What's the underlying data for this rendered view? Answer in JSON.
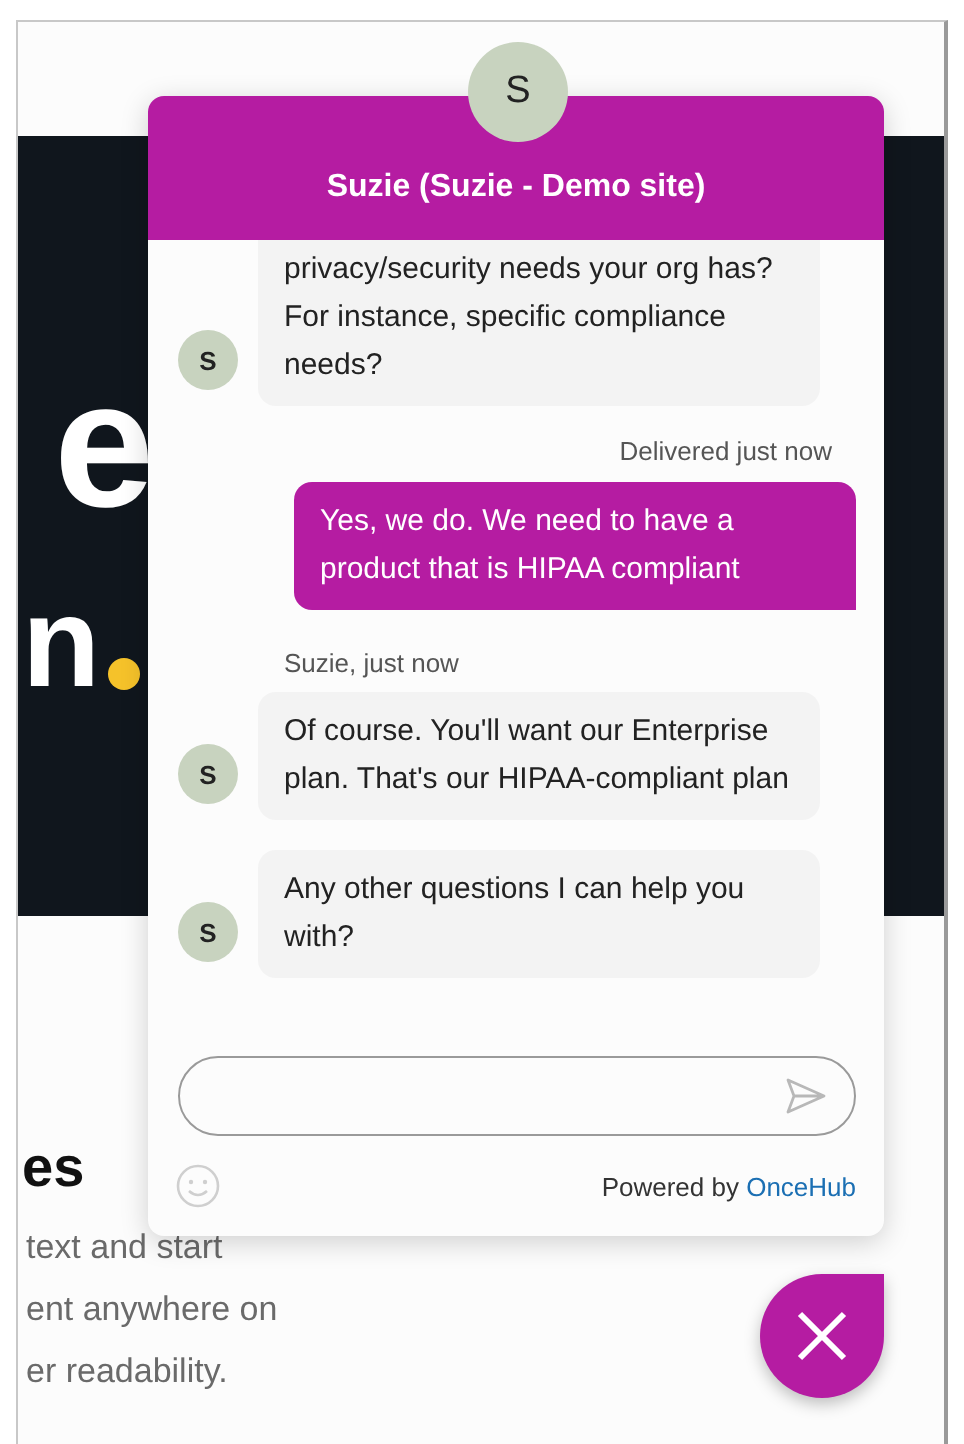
{
  "site": {
    "hero_fragments": [
      "e",
      "n"
    ],
    "section_heading": "es",
    "paragraph_lines": [
      "text and start",
      "ent anywhere on",
      "er readability."
    ]
  },
  "chat": {
    "agent_initial": "S",
    "title": "Suzie (Suzie - Demo site)",
    "messages": [
      {
        "kind": "agent",
        "avatar": "S",
        "text": "privacy/security needs your org has? For instance, specific compliance needs?"
      },
      {
        "kind": "delivery",
        "text": "Delivered just now"
      },
      {
        "kind": "visitor",
        "text": "Yes, we do. We need to have a product that is HIPAA compliant"
      },
      {
        "kind": "sender",
        "text": "Suzie, just now"
      },
      {
        "kind": "agent",
        "avatar": "S",
        "text": "Of course. You'll want our Enterprise plan. That's our HIPAA-compliant plan"
      },
      {
        "kind": "agent",
        "avatar": "S",
        "text": "Any other questions I can help you with?"
      }
    ],
    "powered_by": "Powered by",
    "powered_link": "OnceHub"
  }
}
